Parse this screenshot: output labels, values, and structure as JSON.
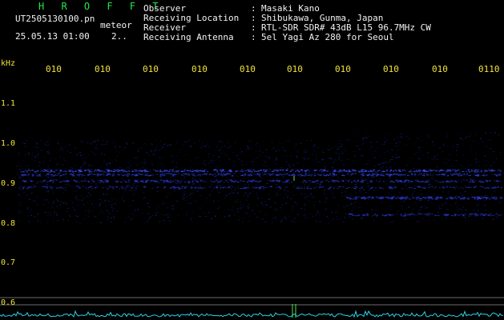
{
  "header": {
    "brand": "H R O F F T",
    "filename": "UT2505130100.pn",
    "mode": "meteor",
    "datetime": "25.05.13 01:00",
    "interval": "2.."
  },
  "station_info": [
    {
      "key": "Observer",
      "sep": ":",
      "value": "Masaki Kano"
    },
    {
      "key": "Receiving Location",
      "sep": ":",
      "value": "Shibukawa, Gunma, Japan"
    },
    {
      "key": "Receiver",
      "sep": ":",
      "value": "RTL-SDR SDR# 43dB L15 96.7MHz CW"
    },
    {
      "key": "Receiving Antenna",
      "sep": ":",
      "value": "5el Yagi Az 280 for Seoul"
    }
  ],
  "axis": {
    "unit": "kHz",
    "y_ticks": [
      "1.1",
      "1.0",
      "0.9",
      "0.8",
      "0.7",
      "0.6"
    ],
    "time_marks": [
      "010",
      "010",
      "010",
      "010",
      "010",
      "010",
      "010",
      "010",
      "010",
      "0110"
    ]
  },
  "colors": {
    "background": "#000000",
    "axis_text": "#f2e23a",
    "brand": "#22e84c",
    "signal": "#2a3bd6",
    "meteor": "#58e04a",
    "level": "#2fd0e6",
    "gridline": "#6b6b6b"
  }
}
